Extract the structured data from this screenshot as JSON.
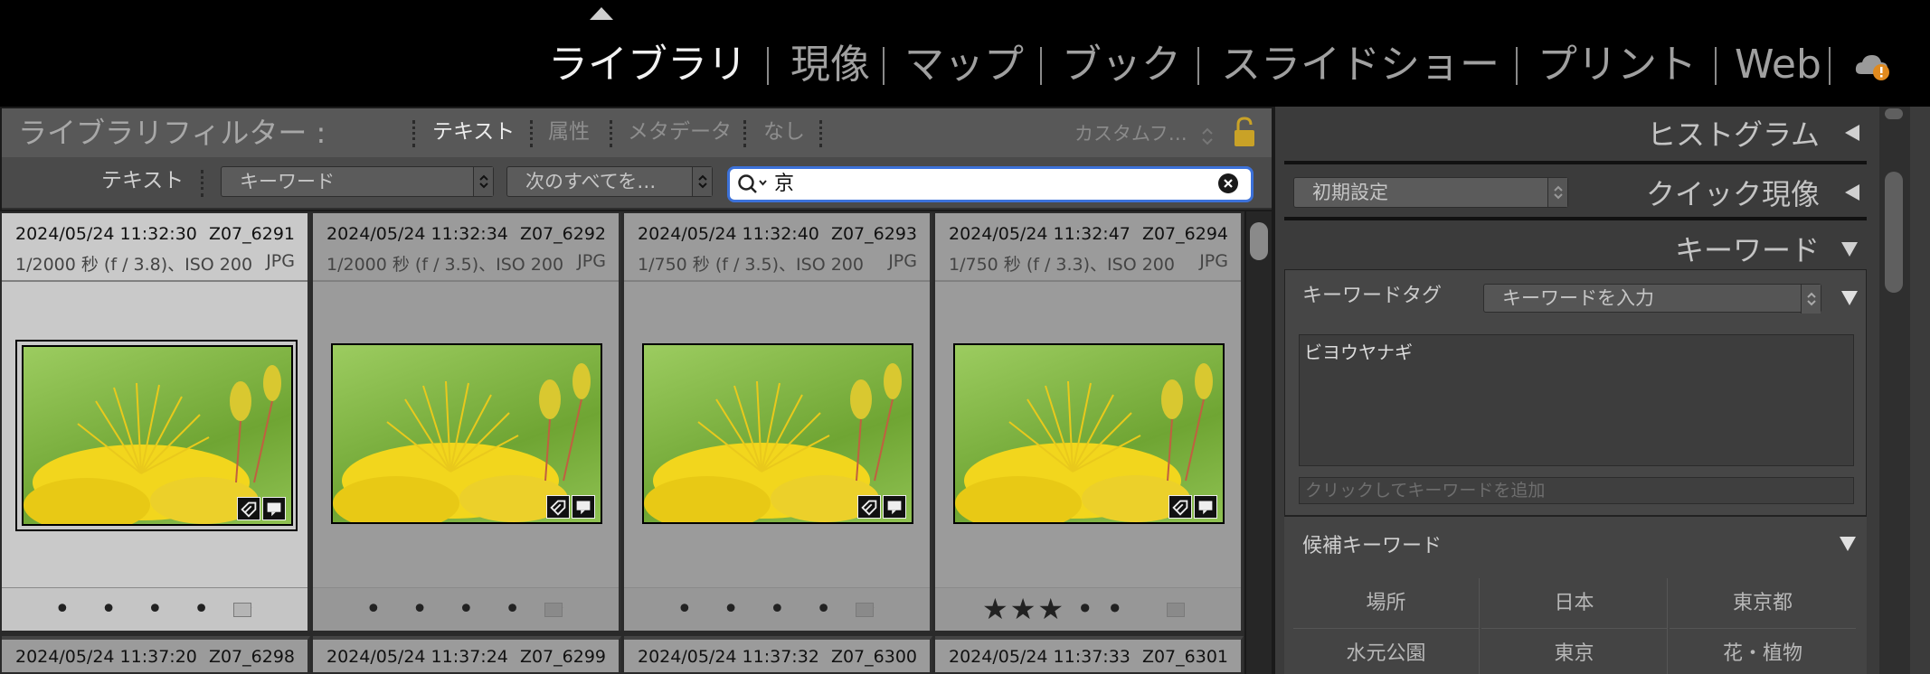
{
  "modules": [
    {
      "label": "ライブラリ",
      "active": true
    },
    {
      "label": "現像",
      "active": false
    },
    {
      "label": "マップ",
      "active": false
    },
    {
      "label": "ブック",
      "active": false
    },
    {
      "label": "スライドショー",
      "active": false
    },
    {
      "label": "プリント",
      "active": false
    },
    {
      "label": "Web",
      "active": false
    }
  ],
  "filter_bar": {
    "title": "ライブラリフィルター :",
    "tabs": [
      "テキスト",
      "属性",
      "メタデータ",
      "なし"
    ],
    "active_tab": "テキスト",
    "custom_filter": "カスタムフ…"
  },
  "text_filter": {
    "label": "テキスト",
    "field_select": "キーワード",
    "rule_select": "次のすべてを…",
    "search_value": "京"
  },
  "grid": {
    "cells": [
      {
        "date": "2024/05/24 11:32:30",
        "name": "Z07_6291",
        "exif": "1/2000 秒 (f / 3.8)、ISO 200",
        "format": "JPG",
        "rating": "• • • • •",
        "stars": "",
        "selected": true
      },
      {
        "date": "2024/05/24 11:32:34",
        "name": "Z07_6292",
        "exif": "1/2000 秒 (f / 3.5)、ISO 200",
        "format": "JPG",
        "rating": "• • • • •",
        "stars": "",
        "selected": false
      },
      {
        "date": "2024/05/24 11:32:40",
        "name": "Z07_6293",
        "exif": "1/750 秒 (f / 3.5)、ISO 200",
        "format": "JPG",
        "rating": "• • • • •",
        "stars": "",
        "selected": false
      },
      {
        "date": "2024/05/24 11:32:47",
        "name": "Z07_6294",
        "exif": "1/750 秒 (f / 3.3)、ISO 200",
        "format": "JPG",
        "rating": "• •",
        "stars": "★★★",
        "selected": false
      }
    ],
    "row2": [
      {
        "date": "2024/05/24 11:37:20",
        "name": "Z07_6298"
      },
      {
        "date": "2024/05/24 11:37:24",
        "name": "Z07_6299"
      },
      {
        "date": "2024/05/24 11:37:32",
        "name": "Z07_6300"
      },
      {
        "date": "2024/05/24 11:37:33",
        "name": "Z07_6301"
      }
    ]
  },
  "right_panel": {
    "histogram": "ヒストグラム",
    "preset": "初期設定",
    "quick_develop": "クイック現像",
    "keywording": "キーワード",
    "keyword_tags_label": "キーワードタグ",
    "keyword_tags_select": "キーワードを入力",
    "keywords_text": "ビヨウヤナギ",
    "add_keyword_placeholder": "クリックしてキーワードを追加",
    "suggestions_title": "候補キーワード",
    "suggestions": [
      "場所",
      "日本",
      "東京都",
      "水元公園",
      "東京",
      "花・植物"
    ]
  }
}
